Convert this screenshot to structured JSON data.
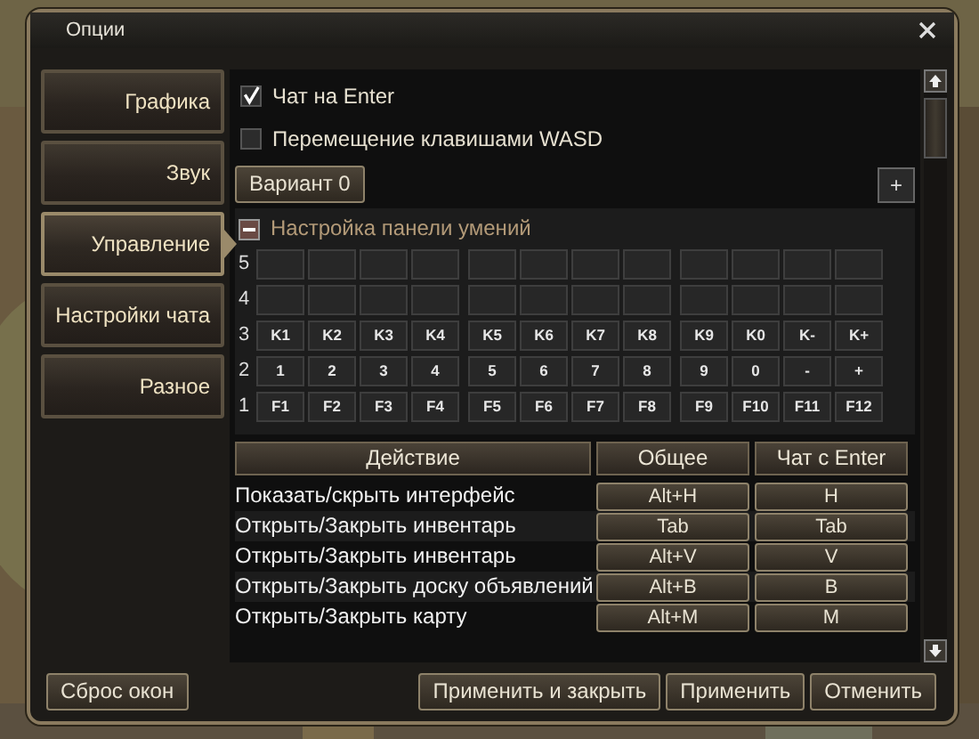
{
  "window": {
    "title": "Опции"
  },
  "sidebar": {
    "items": [
      {
        "label": "Графика",
        "selected": false
      },
      {
        "label": "Звук",
        "selected": false
      },
      {
        "label": "Управление",
        "selected": true
      },
      {
        "label": "Настройки чата",
        "selected": false
      },
      {
        "label": "Разное",
        "selected": false
      }
    ],
    "reset_button": "Сброс окон"
  },
  "options": [
    {
      "label": "Чат на Enter",
      "checked": true
    },
    {
      "label": "Перемещение клавишами WASD",
      "checked": false
    }
  ],
  "variant": {
    "label": "Вариант 0",
    "add_button": "+"
  },
  "skill_panel": {
    "title": "Настройка панели умений",
    "expanded": true,
    "rows": [
      {
        "number": "5"
      },
      {
        "number": "4"
      },
      {
        "number": "3",
        "keys": [
          "K1",
          "K2",
          "K3",
          "K4",
          "K5",
          "K6",
          "K7",
          "K8",
          "K9",
          "K0",
          "K-",
          "K+"
        ]
      },
      {
        "number": "2",
        "keys": [
          "1",
          "2",
          "3",
          "4",
          "5",
          "6",
          "7",
          "8",
          "9",
          "0",
          "-",
          "+"
        ]
      },
      {
        "number": "1",
        "keys": [
          "F1",
          "F2",
          "F3",
          "F4",
          "F5",
          "F6",
          "F7",
          "F8",
          "F9",
          "F10",
          "F11",
          "F12"
        ]
      }
    ]
  },
  "bindings": {
    "columns": [
      "Действие",
      "Общее",
      "Чат с Enter"
    ],
    "rows": [
      {
        "action": "Показать/скрыть интерфейс",
        "general": "Alt+H",
        "chat": "H"
      },
      {
        "action": "Открыть/Закрыть инвентарь",
        "general": "Tab",
        "chat": "Tab"
      },
      {
        "action": "Открыть/Закрыть инвентарь",
        "general": "Alt+V",
        "chat": "V"
      },
      {
        "action": "Открыть/Закрыть доску объявлений",
        "general": "Alt+B",
        "chat": "B"
      },
      {
        "action": "Открыть/Закрыть карту",
        "general": "Alt+M",
        "chat": "M"
      }
    ]
  },
  "buttons": [
    "Применить и закрыть",
    "Применить",
    "Отменить"
  ]
}
